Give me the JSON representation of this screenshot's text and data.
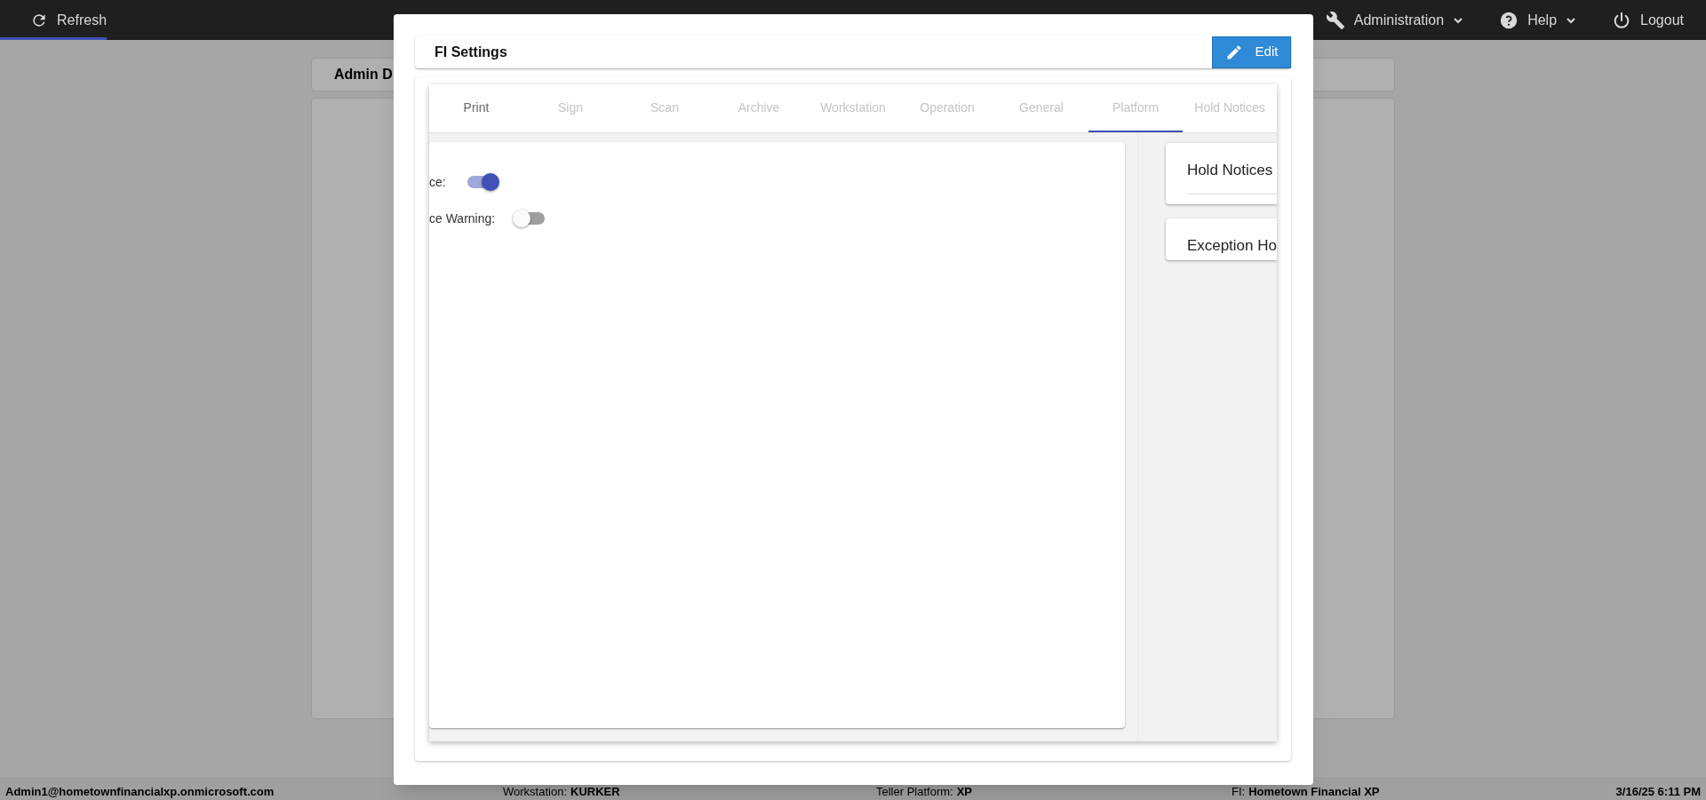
{
  "top_bar": {
    "items": [
      {
        "kind": "refresh",
        "label": "Refresh",
        "dropdown": false,
        "selected": true
      },
      {
        "kind": "admin",
        "label": "Administration",
        "dropdown": true,
        "selected": false
      },
      {
        "kind": "help",
        "label": "Help",
        "dropdown": true,
        "selected": false
      },
      {
        "kind": "logout",
        "label": "Logout",
        "dropdown": false,
        "selected": false
      }
    ]
  },
  "background": {
    "panel_title": "Admin D"
  },
  "dialog": {
    "title": "FI Settings",
    "edit_button": "Edit",
    "tabs": [
      {
        "label": "Print",
        "selected": false,
        "disabled": false
      },
      {
        "label": "Sign",
        "selected": false,
        "disabled": true
      },
      {
        "label": "Scan",
        "selected": false,
        "disabled": true
      },
      {
        "label": "Archive",
        "selected": false,
        "disabled": true
      },
      {
        "label": "Workstation",
        "selected": false,
        "disabled": true
      },
      {
        "label": "Operation",
        "selected": false,
        "disabled": true
      },
      {
        "label": "General",
        "selected": false,
        "disabled": true
      },
      {
        "label": "Platform",
        "selected": true,
        "disabled": true
      },
      {
        "label": "Hold Notices",
        "selected": false,
        "disabled": true
      }
    ],
    "settings": [
      {
        "label": "ce:",
        "on": true
      },
      {
        "label": "ce Warning:",
        "on": false
      }
    ],
    "side_cards": [
      {
        "title": "Hold Notices",
        "divider": true
      },
      {
        "title": "Exception Ho",
        "divider": false
      }
    ]
  },
  "status_bar": {
    "user": "Admin1@hometownfinancialxp.onmicrosoft.com",
    "workstation_label": "Workstation:",
    "workstation": "KURKER",
    "platform_label": "Teller Platform:",
    "platform": "XP",
    "fi_label": "FI:",
    "fi": "Hometown Financial XP",
    "datetime": "3/16/25 6:11 PM"
  }
}
